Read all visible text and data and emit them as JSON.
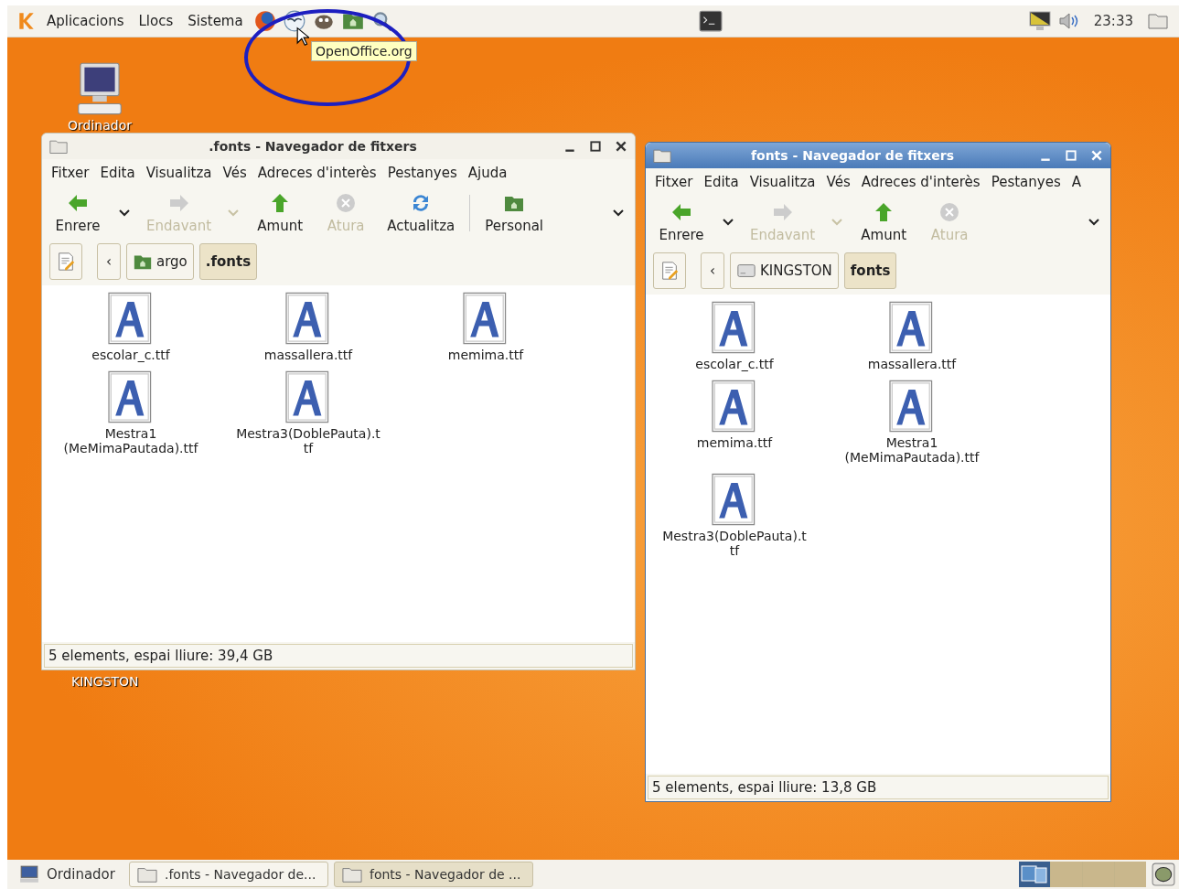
{
  "top_panel": {
    "menus": [
      "Aplicacions",
      "Llocs",
      "Sistema"
    ],
    "tooltip": "OpenOffice.org",
    "clock": "23:33"
  },
  "desktop_icons": [
    {
      "label": "Ordinador",
      "kind": "computer"
    },
    {
      "label": "KINGSTON",
      "kind": "hidden"
    }
  ],
  "windows": [
    {
      "title": ".fonts - Navegador de fitxers",
      "active": false,
      "menus": [
        "Fitxer",
        "Edita",
        "Visualitza",
        "Vés",
        "Adreces d'interès",
        "Pestanyes",
        "Ajuda"
      ],
      "toolbar": [
        {
          "kind": "back",
          "label": "Enrere",
          "disabled": false
        },
        {
          "kind": "dropdown",
          "disabled": false
        },
        {
          "kind": "forward",
          "label": "Endavant",
          "disabled": true
        },
        {
          "kind": "dropdown",
          "disabled": true
        },
        {
          "kind": "up",
          "label": "Amunt",
          "disabled": false
        },
        {
          "kind": "stop",
          "label": "Atura",
          "disabled": true
        },
        {
          "kind": "reload",
          "label": "Actualitza",
          "disabled": false
        },
        {
          "kind": "separator"
        },
        {
          "kind": "home",
          "label": "Personal",
          "disabled": false
        }
      ],
      "back_button": "‹",
      "path": [
        {
          "label": "argo",
          "kind": "home",
          "selected": false
        },
        {
          "label": ".fonts",
          "kind": "plain",
          "selected": true
        }
      ],
      "files": [
        "escolar_c.ttf",
        "massallera.ttf",
        "memima.ttf",
        "Mestra1 (MeMimaPautada).ttf",
        "Mestra3(DoblePauta).ttf"
      ],
      "status": "5 elements, espai lliure: 39,4 GB"
    },
    {
      "title": "fonts - Navegador de fitxers",
      "active": true,
      "menus": [
        "Fitxer",
        "Edita",
        "Visualitza",
        "Vés",
        "Adreces d'interès",
        "Pestanyes",
        "A"
      ],
      "toolbar": [
        {
          "kind": "back",
          "label": "Enrere",
          "disabled": false
        },
        {
          "kind": "dropdown",
          "disabled": false
        },
        {
          "kind": "forward",
          "label": "Endavant",
          "disabled": true
        },
        {
          "kind": "dropdown",
          "disabled": true
        },
        {
          "kind": "up",
          "label": "Amunt",
          "disabled": false
        },
        {
          "kind": "stop",
          "label": "Atura",
          "disabled": true
        }
      ],
      "back_button": "‹",
      "path": [
        {
          "label": "KINGSTON",
          "kind": "drive",
          "selected": false
        },
        {
          "label": "fonts",
          "kind": "plain",
          "selected": true
        }
      ],
      "files": [
        "escolar_c.ttf",
        "massallera.ttf",
        "memima.ttf",
        "Mestra1 (MeMimaPautada).ttf",
        "Mestra3(DoblePauta).ttf"
      ],
      "status": "5 elements, espai lliure: 13,8 GB"
    }
  ],
  "taskbar": {
    "show_desktop": "Ordinador",
    "tasks": [
      {
        "label": ".fonts - Navegador de...",
        "selected": false
      },
      {
        "label": "fonts - Navegador de ...",
        "selected": true
      }
    ],
    "workspaces": [
      {
        "selected": true
      },
      {
        "selected": false
      },
      {
        "selected": false
      },
      {
        "selected": false
      }
    ]
  }
}
